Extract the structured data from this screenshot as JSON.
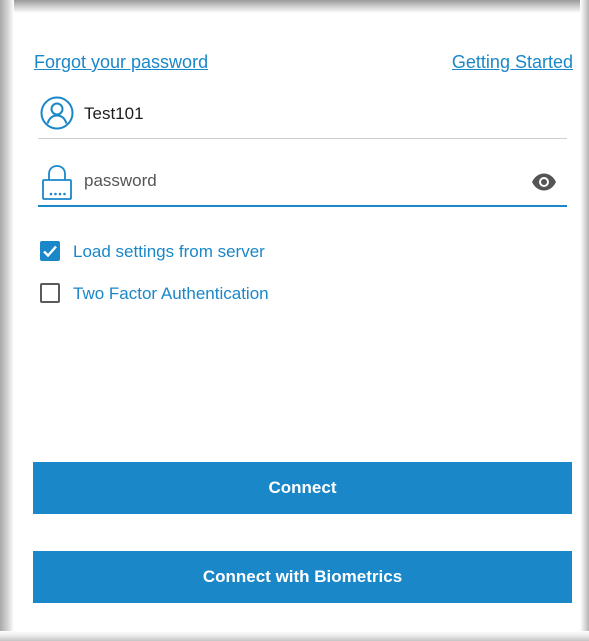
{
  "links": {
    "forgot_password": "Forgot your password",
    "getting_started": "Getting Started"
  },
  "username": {
    "value": "Test101",
    "icon": "user-circle-icon"
  },
  "password": {
    "value": "",
    "placeholder": "password",
    "icon": "lock-icon",
    "toggle_icon": "eye-icon"
  },
  "options": [
    {
      "label": "Load settings from server",
      "checked": true
    },
    {
      "label": "Two Factor Authentication",
      "checked": false
    }
  ],
  "buttons": {
    "connect": "Connect",
    "connect_biometrics": "Connect with Biometrics"
  },
  "colors": {
    "accent": "#1a87c9",
    "text": "#1e1e1e",
    "button_text": "#ffffff"
  }
}
